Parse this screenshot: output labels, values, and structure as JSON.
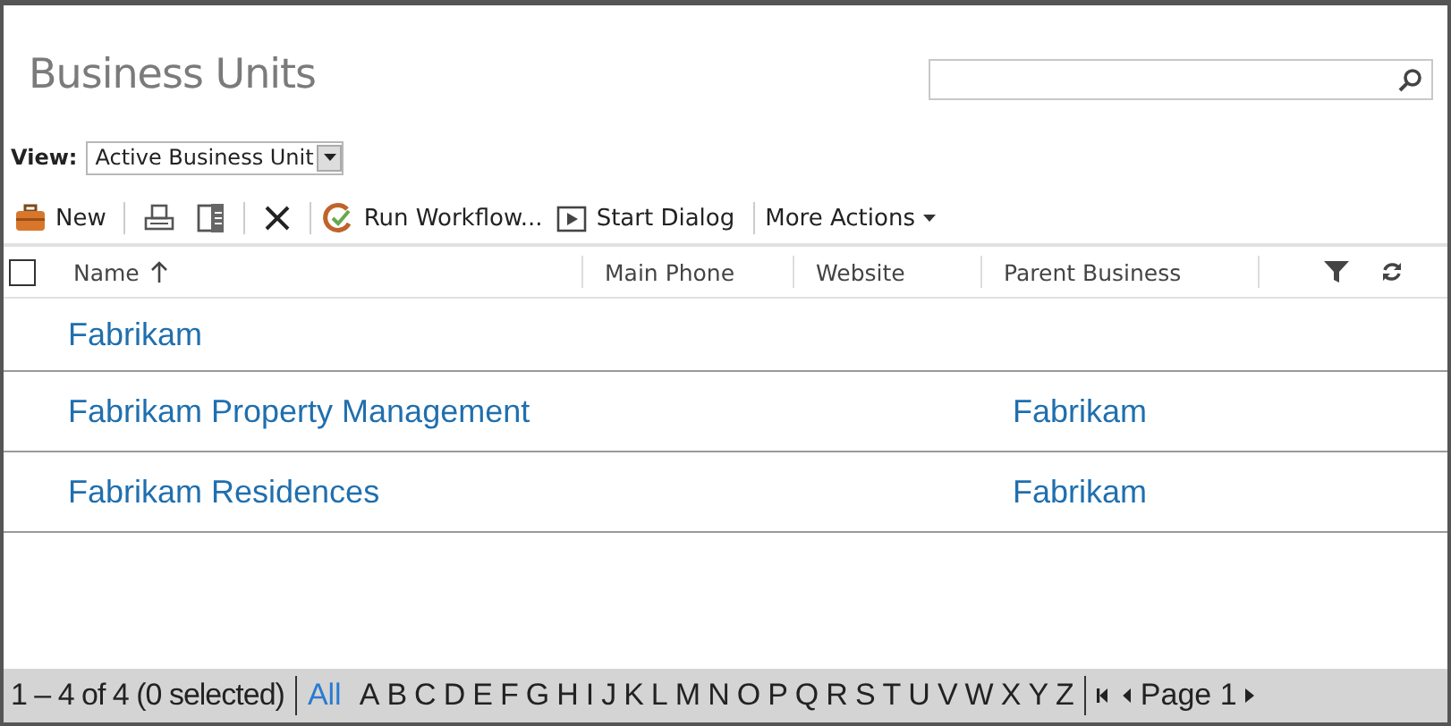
{
  "page": {
    "title": "Business Units"
  },
  "view": {
    "label": "View:",
    "value": "Active Business Unit"
  },
  "toolbar": [
    [
      {
        "kind": "new",
        "label": "New"
      }
    ],
    [
      {
        "kind": "print"
      },
      {
        "kind": "export"
      }
    ],
    [
      {
        "kind": "delete"
      }
    ],
    [
      {
        "kind": "workflow",
        "label": "Run Workflow..."
      },
      {
        "kind": "dialog",
        "label": "Start Dialog"
      }
    ],
    [
      {
        "kind": "more",
        "label": "More Actions"
      }
    ]
  ],
  "table": {
    "select_all": {
      "checked": false
    },
    "columns": [
      {
        "label": "Name",
        "sorted": true
      },
      {
        "label": "Main Phone",
        "sorted": false
      },
      {
        "label": "Website",
        "sorted": false
      },
      {
        "label": "Parent Business",
        "sorted": false
      }
    ],
    "rows": [
      {
        "name": "Fabrikam"
      },
      {
        "name": "Fabrikam Property Management",
        "parent": "Fabrikam"
      },
      {
        "name": "Fabrikam Residences",
        "parent": "Fabrikam"
      }
    ]
  },
  "status_bar": {
    "count": "1 – 4 of 4 (0 selected)",
    "letters": [
      {
        "label": "All",
        "selected": true
      },
      {
        "label": "A",
        "selected": false
      },
      {
        "label": "B",
        "selected": false
      },
      {
        "label": "C",
        "selected": false
      },
      {
        "label": "D",
        "selected": false
      },
      {
        "label": "E",
        "selected": false
      },
      {
        "label": "F",
        "selected": false
      },
      {
        "label": "G",
        "selected": false
      },
      {
        "label": "H",
        "selected": false
      },
      {
        "label": "I",
        "selected": false
      },
      {
        "label": "J",
        "selected": false
      },
      {
        "label": "K",
        "selected": false
      },
      {
        "label": "L",
        "selected": false
      },
      {
        "label": "M",
        "selected": false
      },
      {
        "label": "N",
        "selected": false
      },
      {
        "label": "O",
        "selected": false
      },
      {
        "label": "P",
        "selected": false
      },
      {
        "label": "Q",
        "selected": false
      },
      {
        "label": "R",
        "selected": false
      },
      {
        "label": "S",
        "selected": false
      },
      {
        "label": "T",
        "selected": false
      },
      {
        "label": "U",
        "selected": false
      },
      {
        "label": "V",
        "selected": false
      },
      {
        "label": "W",
        "selected": false
      },
      {
        "label": "X",
        "selected": false
      },
      {
        "label": "Y",
        "selected": false
      },
      {
        "label": "Z",
        "selected": false
      }
    ],
    "page": "Page 1"
  }
}
